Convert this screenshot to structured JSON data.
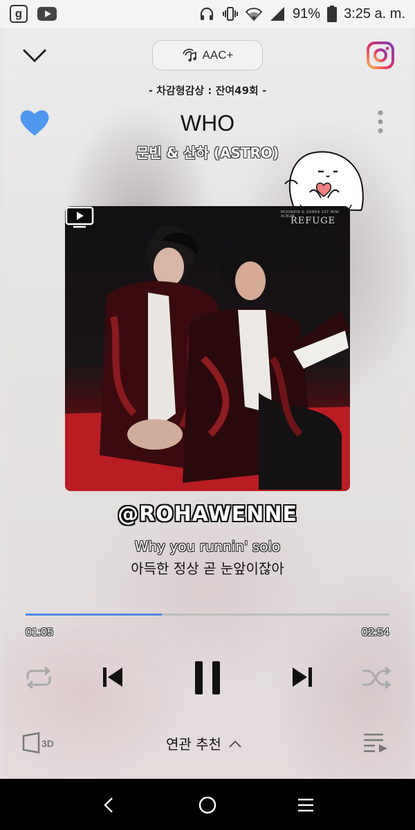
{
  "status_bar": {
    "app_icons": [
      "g-app-icon",
      "youtube-icon"
    ],
    "indicator_icons": [
      "headphones-icon",
      "vibrate-icon",
      "wifi-icon",
      "signal-icon"
    ],
    "battery": "91%",
    "time": "3:25 a. m."
  },
  "header": {
    "quality_label": "AAC+",
    "chart_text": "- 차감형감상 : 잔여49회 -"
  },
  "song": {
    "title": "WHO",
    "artist": "문빈 & 산하 (ASTRO)",
    "liked": true
  },
  "album": {
    "text": "REFUGE",
    "small_text": "MOONBIN & SANHA 1ST MINI ALBUM"
  },
  "watermark": "@ROHAWENNE",
  "lyrics": {
    "current": "Why you runnin' solo",
    "next": "아득한 정상 곧 눈앞이잖아"
  },
  "playback": {
    "current_time": "01:05",
    "total_time": "02:54",
    "progress": 0.375,
    "state": "playing"
  },
  "bottom": {
    "related_label": "연관 추천",
    "sound_effect_label": "3D"
  },
  "colors": {
    "accent": "#4d86e8",
    "heart": "#4f97f0"
  }
}
